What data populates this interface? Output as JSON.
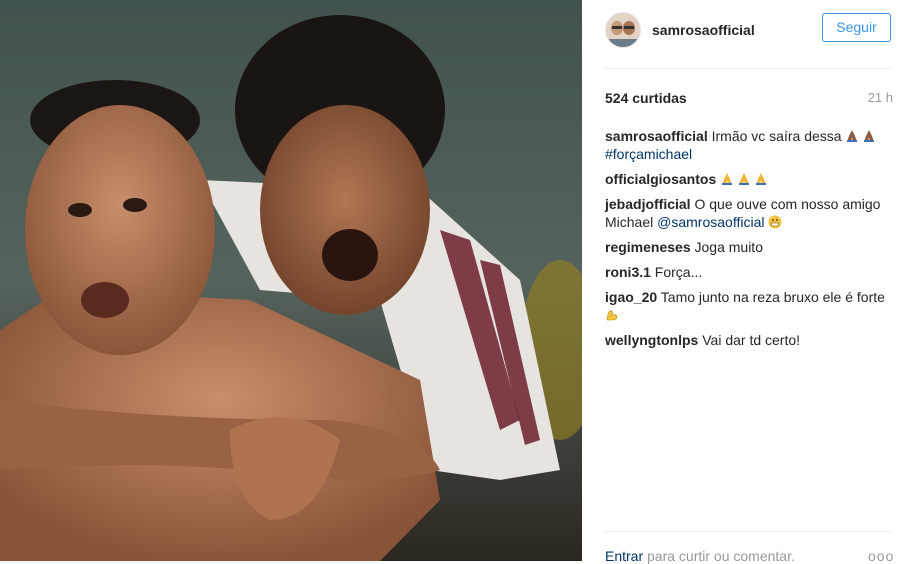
{
  "post": {
    "photo_alt": "",
    "author": "samrosaofficial",
    "follow_label": "Seguir",
    "likes": "524 curtidas",
    "time": "21 h",
    "caption": {
      "user": "samrosaofficial",
      "text": "Irmão vc saíra dessa",
      "emoji": "prayer-icon",
      "hashtag": "#forçamichael"
    },
    "comments": [
      {
        "user": "officialgiosantos",
        "text": "",
        "emoji_count": 3
      },
      {
        "user": "jebadjofficial",
        "text": "O que ouve com nosso amigo Michael",
        "mention": "@samrosaofficial",
        "emoji": "grimace-icon"
      },
      {
        "user": "regimeneses",
        "text": "Joga muito"
      },
      {
        "user": "roni3.1",
        "text": "Força..."
      },
      {
        "user": "igao_20",
        "text": "Tamo junto na reza bruxo ele é forte",
        "emoji": "flexed-bicep-icon"
      },
      {
        "user": "wellyngtonlps",
        "text": "Vai dar td certo!"
      }
    ],
    "footer": {
      "login": "Entrar",
      "rest": " para curtir ou comentar.",
      "more": "ooo"
    }
  },
  "colors": {
    "accent": "#3897f0",
    "link": "#003569",
    "muted": "#999999"
  }
}
